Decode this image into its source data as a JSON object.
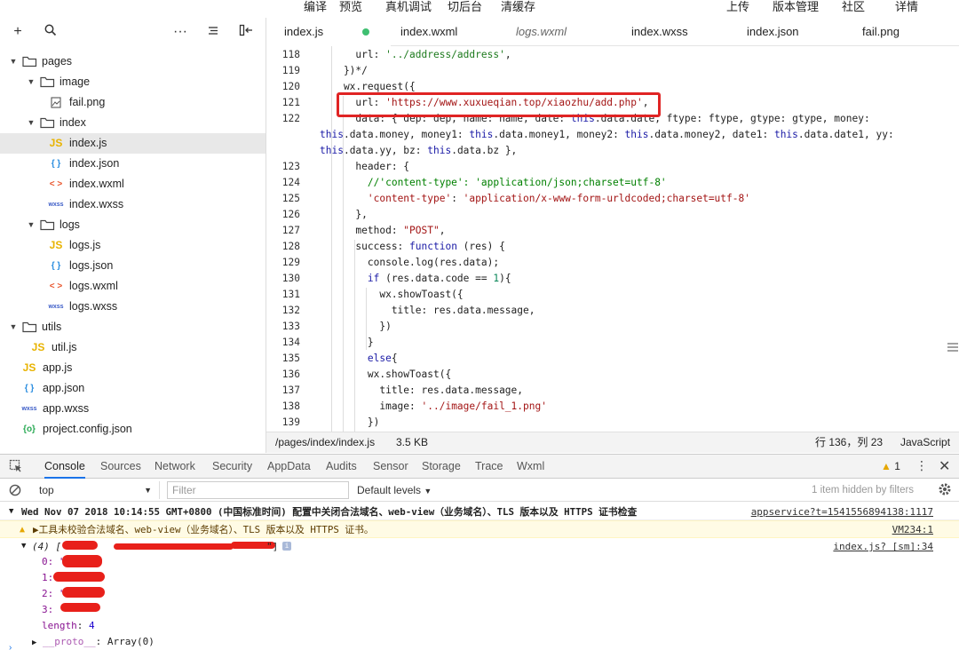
{
  "toolbar": {
    "compile": "编译",
    "preview": "预览",
    "remote_debug": "真机调试",
    "background": "切后台",
    "clear_cache": "清缓存",
    "upload": "上传",
    "version": "版本管理",
    "community": "社区",
    "details": "详情"
  },
  "sidebar": {
    "icons": [
      "plus-icon",
      "search-icon",
      "more-icon",
      "sort-icon",
      "collapse-icon"
    ],
    "tree": [
      {
        "label": "pages",
        "type": "folder",
        "depth": 0
      },
      {
        "label": "image",
        "type": "folder",
        "depth": 1
      },
      {
        "label": "fail.png",
        "type": "image",
        "depth": 2
      },
      {
        "label": "index",
        "type": "folder",
        "depth": 1
      },
      {
        "label": "index.js",
        "type": "js",
        "depth": 2,
        "selected": true
      },
      {
        "label": "index.json",
        "type": "json",
        "depth": 2
      },
      {
        "label": "index.wxml",
        "type": "wxml",
        "depth": 2
      },
      {
        "label": "index.wxss",
        "type": "wxss",
        "depth": 2
      },
      {
        "label": "logs",
        "type": "folder",
        "depth": 1
      },
      {
        "label": "logs.js",
        "type": "js",
        "depth": 2
      },
      {
        "label": "logs.json",
        "type": "json",
        "depth": 2
      },
      {
        "label": "logs.wxml",
        "type": "wxml",
        "depth": 2
      },
      {
        "label": "logs.wxss",
        "type": "wxss",
        "depth": 2
      },
      {
        "label": "utils",
        "type": "folder",
        "depth": 0
      },
      {
        "label": "util.js",
        "type": "js",
        "depth": 1
      },
      {
        "label": "app.js",
        "type": "js",
        "depth": 0
      },
      {
        "label": "app.json",
        "type": "json",
        "depth": 0
      },
      {
        "label": "app.wxss",
        "type": "wxss",
        "depth": 0
      },
      {
        "label": "project.config.json",
        "type": "config",
        "depth": 0
      }
    ],
    "file_icon_glyphs": {
      "js": "JS",
      "json": "{ }",
      "wxml": "< >",
      "wxss": "wxss",
      "config": "{o}"
    }
  },
  "tabs": [
    {
      "label": "index.js",
      "active": true,
      "modified": true
    },
    {
      "label": "index.wxml"
    },
    {
      "label": "logs.wxml",
      "preview": true
    },
    {
      "label": "index.wxss"
    },
    {
      "label": "index.json"
    },
    {
      "label": "fail.png"
    }
  ],
  "editor": {
    "lines": [
      {
        "n": "118",
        "html": "      url: <span class='sg'>'../address/address'</span>,"
      },
      {
        "n": "119",
        "html": "    })*/"
      },
      {
        "n": "120",
        "html": "    wx.request({"
      },
      {
        "n": "121",
        "html": "      url: <span class='s'>'https://www.xuxueqian.top/xiaozhu/add.php'</span>,"
      },
      {
        "n": "122",
        "html": "      data: { dep: dep, name: name, date: <span class='k'>this</span>.data.date, ftype: ftype, gtype: gtype, money:"
      },
      {
        "n": "",
        "html": "<span class='k'>this</span>.data.money, money1: <span class='k'>this</span>.data.money1, money2: <span class='k'>this</span>.data.money2, date1: <span class='k'>this</span>.data.date1, yy:",
        "wrap": true
      },
      {
        "n": "",
        "html": "<span class='k'>this</span>.data.yy, bz: <span class='k'>this</span>.data.bz },",
        "wrap": true
      },
      {
        "n": "123",
        "html": "      header: {"
      },
      {
        "n": "124",
        "html": "        <span class='c'>//'content-type': 'application/json;charset=utf-8'</span>"
      },
      {
        "n": "125",
        "html": "        <span class='s'>'content-type'</span>: <span class='s'>'application/x-www-form-urldcoded;charset=utf-8'</span>"
      },
      {
        "n": "126",
        "html": "      },"
      },
      {
        "n": "127",
        "html": "      method: <span class='s'>\"POST\"</span>,"
      },
      {
        "n": "128",
        "html": "      success: <span class='k'>function</span> (res) {"
      },
      {
        "n": "129",
        "html": "        console.log(res.data);"
      },
      {
        "n": "130",
        "html": "        <span class='k'>if</span> (res.data.code == <span class='n'>1</span>){"
      },
      {
        "n": "131",
        "html": "          wx.showToast({"
      },
      {
        "n": "132",
        "html": "            title: res.data.message,"
      },
      {
        "n": "133",
        "html": "          })"
      },
      {
        "n": "134",
        "html": "        }"
      },
      {
        "n": "135",
        "html": "        <span class='k'>else</span>{"
      },
      {
        "n": "136",
        "html": "        wx.showToast({"
      },
      {
        "n": "137",
        "html": "          title: res.data.message,"
      },
      {
        "n": "138",
        "html": "          image: <span class='s'>'../image/fail_1.png'</span>"
      },
      {
        "n": "139",
        "html": "        })"
      }
    ]
  },
  "statusbar": {
    "path": "/pages/index/index.js",
    "size": "3.5 KB",
    "position": "行 136，列 23",
    "language": "JavaScript"
  },
  "devtools": {
    "tabs": [
      "Console",
      "Sources",
      "Network",
      "Security",
      "AppData",
      "Audits",
      "Sensor",
      "Storage",
      "Trace",
      "Wxml"
    ],
    "warning_count": "1",
    "context": "top",
    "filter_placeholder": "Filter",
    "levels": "Default levels",
    "hidden_info": "1 item hidden by filters"
  },
  "console": {
    "msg1": "Wed Nov 07 2018 10:14:55 GMT+0800 (中国标准时间) 配置中关闭合法域名、web-view（业务域名）、TLS 版本以及 HTTPS 证书检查",
    "msg1_src": "appservice?t=1541556894138:1117",
    "msg2": "▶工具未校验合法域名、web-view（业务域名）、TLS 版本以及 HTTPS 证书。",
    "msg2_src": "VM234:1",
    "array_head": "(4) [\"",
    "array_tail": "\"]",
    "array_src": "index.js? [sm]:34",
    "items": [
      "0: \"",
      "1:",
      "2: \"",
      "3: \""
    ],
    "length_key": "length",
    "length_val": "4",
    "proto_key": "__proto__",
    "proto_val": "Array(0)",
    "colors": {
      "warning_bg": "#fffbe5",
      "warning_text": "#5c3c00",
      "key": "#881391"
    }
  }
}
